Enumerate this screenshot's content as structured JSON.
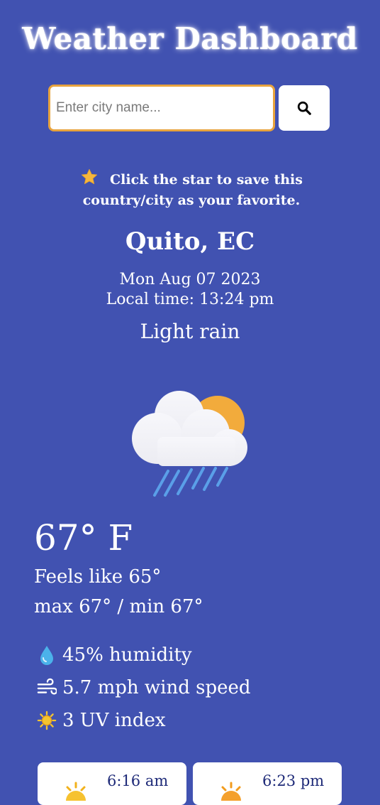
{
  "header": {
    "title": "Weather Dashboard"
  },
  "search": {
    "placeholder": "Enter city name...",
    "value": "",
    "button_icon": "search-icon"
  },
  "favorite": {
    "icon": "star-icon",
    "note": "Click the star to save this country/city as your favorite."
  },
  "location": {
    "city": "Quito, EC"
  },
  "datetime": {
    "date": "Mon Aug 07 2023",
    "local_time": "Local time: 13:24 pm"
  },
  "current": {
    "condition": "Light rain",
    "icon": "cloud-sun-rain-icon",
    "temperature": "67° F",
    "feels_like": "Feels like 65°",
    "minmax": "max 67° / min 67°"
  },
  "stats": {
    "humidity": {
      "icon": "droplet-icon",
      "text": "45% humidity"
    },
    "wind": {
      "icon": "wind-icon",
      "text": "5.7 mph wind speed"
    },
    "uv": {
      "icon": "sun-icon",
      "text": "3 UV index"
    }
  },
  "sun_times": {
    "sunrise": {
      "icon": "sunrise-icon",
      "time": "6:16 am"
    },
    "sunset": {
      "icon": "sunset-icon",
      "time": "6:23 pm"
    }
  },
  "colors": {
    "background": "#4152b1",
    "accent": "#e8a33d",
    "card": "#ffffff"
  }
}
